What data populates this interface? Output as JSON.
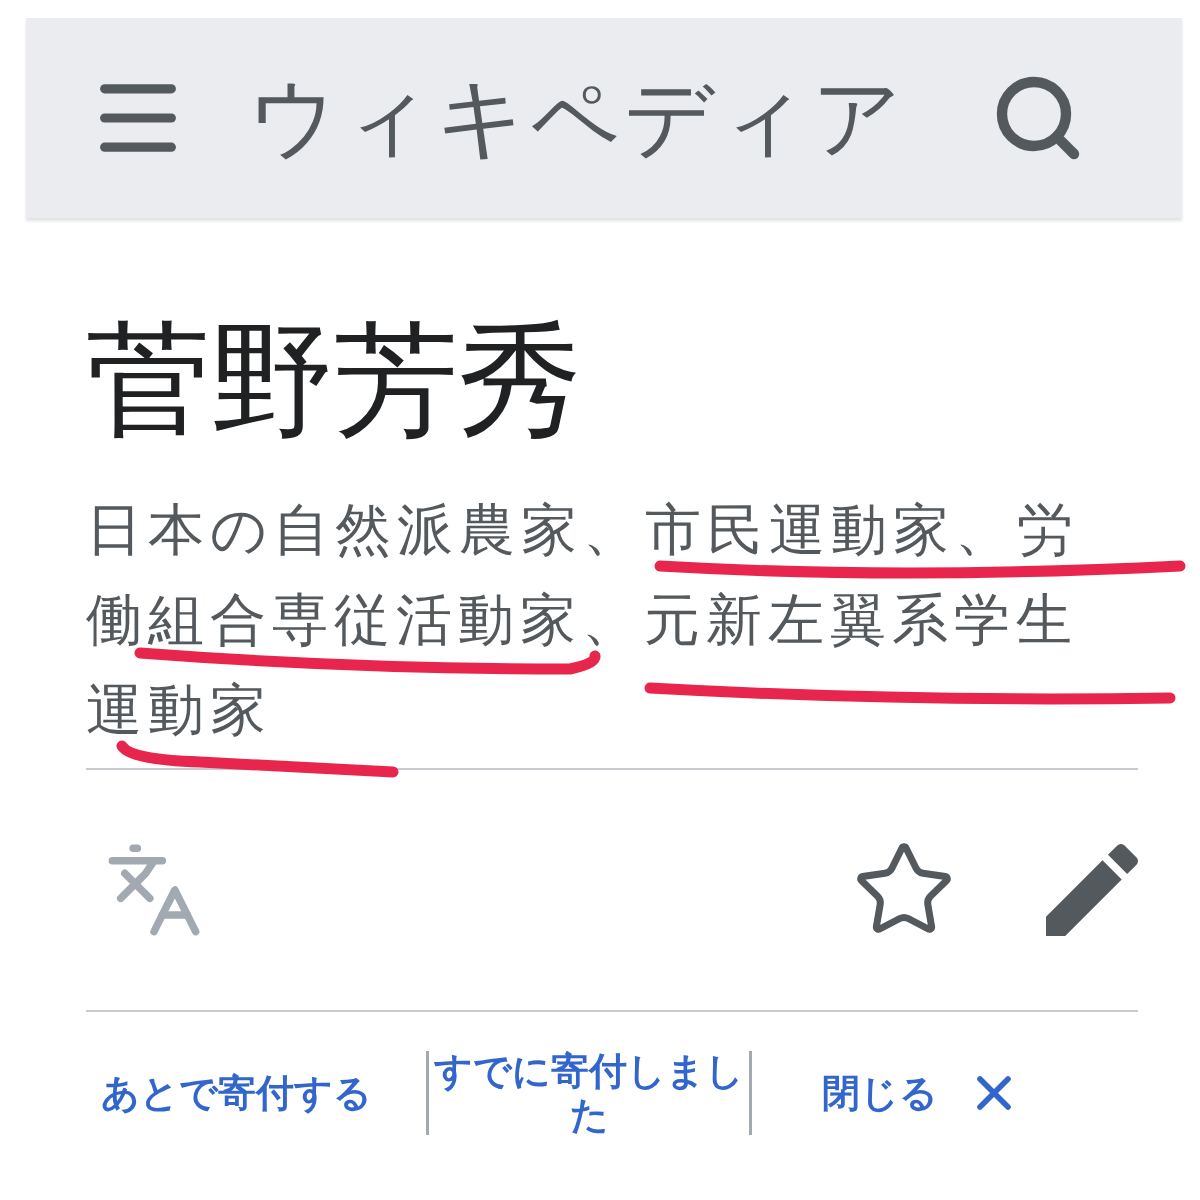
{
  "header": {
    "title": "ウィキペディア"
  },
  "article": {
    "title": "菅野芳秀",
    "description_lines": [
      "日本の自然派農家、市民運動家、労",
      "働組合専従活動家、元新左翼系学生",
      "運動家"
    ]
  },
  "actions": [
    {
      "kind": "link",
      "label": "あとで寄付する"
    },
    {
      "kind": "link",
      "label": "すでに寄付しました"
    },
    {
      "kind": "close",
      "label": "閉じる"
    }
  ]
}
